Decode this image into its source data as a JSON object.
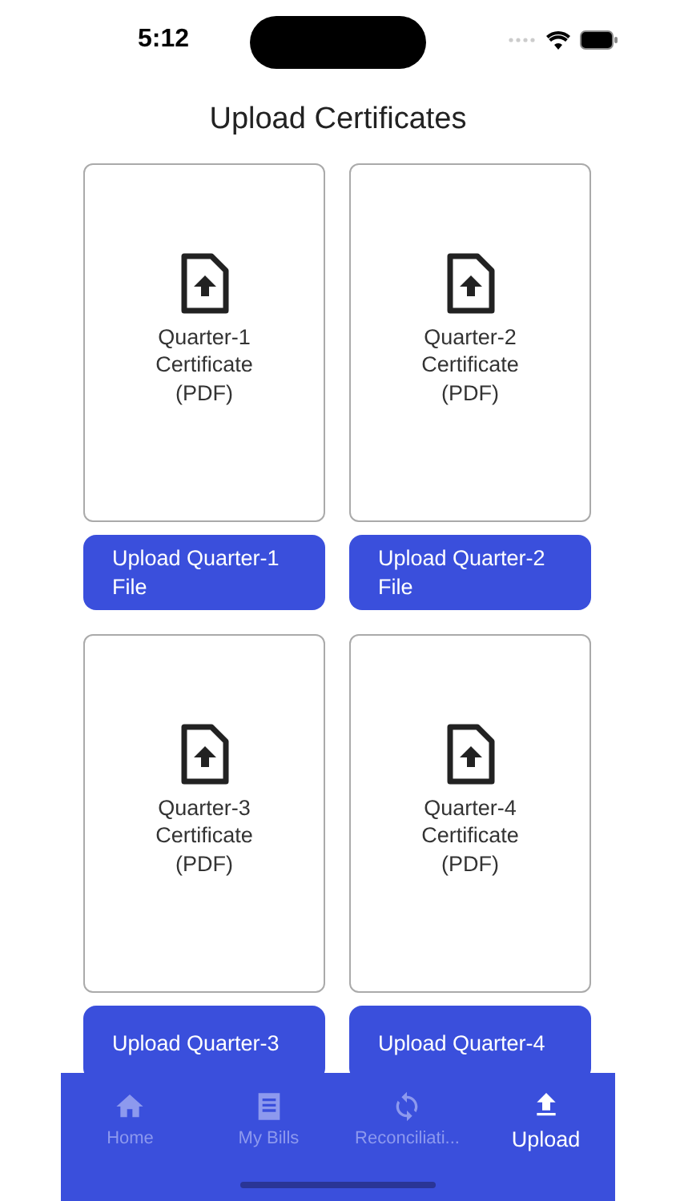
{
  "status_bar": {
    "time": "5:12"
  },
  "title": "Upload Certificates",
  "cards": [
    {
      "label": "Quarter-1\nCertificate\n(PDF)",
      "button": "Upload Quarter-1 File"
    },
    {
      "label": "Quarter-2\nCertificate\n(PDF)",
      "button": "Upload Quarter-2 File"
    },
    {
      "label": "Quarter-3\nCertificate\n(PDF)",
      "button": "Upload Quarter-3"
    },
    {
      "label": "Quarter-4\nCertificate\n(PDF)",
      "button": "Upload Quarter-4"
    }
  ],
  "tabs": [
    {
      "label": "Home",
      "kind": "home",
      "selected": false
    },
    {
      "label": "My Bills",
      "kind": "bills",
      "selected": false
    },
    {
      "label": "Reconciliati...",
      "kind": "sync",
      "selected": false
    },
    {
      "label": "Upload",
      "kind": "upload",
      "selected": true
    }
  ]
}
